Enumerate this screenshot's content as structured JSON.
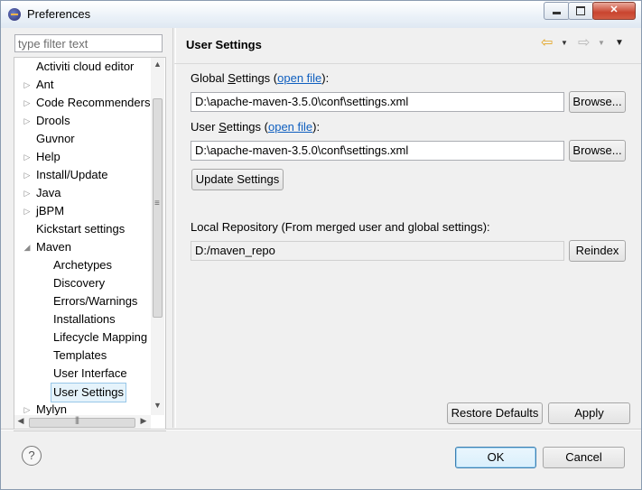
{
  "window": {
    "title": "Preferences"
  },
  "filter": {
    "placeholder": "type filter text"
  },
  "tree": {
    "items": [
      {
        "label": "Activiti cloud editor",
        "expandable": false
      },
      {
        "label": "Ant",
        "expandable": true
      },
      {
        "label": "Code Recommenders",
        "expandable": true
      },
      {
        "label": "Drools",
        "expandable": true
      },
      {
        "label": "Guvnor",
        "expandable": false
      },
      {
        "label": "Help",
        "expandable": true
      },
      {
        "label": "Install/Update",
        "expandable": true
      },
      {
        "label": "Java",
        "expandable": true
      },
      {
        "label": "jBPM",
        "expandable": true
      },
      {
        "label": "Kickstart settings",
        "expandable": false
      },
      {
        "label": "Maven",
        "expandable": true,
        "expanded": true
      },
      {
        "label": "Archetypes",
        "child": true
      },
      {
        "label": "Discovery",
        "child": true
      },
      {
        "label": "Errors/Warnings",
        "child": true
      },
      {
        "label": "Installations",
        "child": true
      },
      {
        "label": "Lifecycle Mapping",
        "child": true
      },
      {
        "label": "Templates",
        "child": true
      },
      {
        "label": "User Interface",
        "child": true
      },
      {
        "label": "User Settings",
        "child": true,
        "selected": true
      },
      {
        "label": "Mylyn",
        "expandable": true
      }
    ]
  },
  "page": {
    "title": "User Settings",
    "global_settings": {
      "label_prefix": "Global ",
      "label_mnemonic": "S",
      "label_suffix": "ettings (",
      "link": "open file",
      "label_end": "):",
      "value": "D:\\apache-maven-3.5.0\\conf\\settings.xml",
      "browse": "Browse..."
    },
    "user_settings": {
      "label_prefix": "User ",
      "label_mnemonic": "S",
      "label_suffix": "ettings (",
      "link": "open file",
      "label_end": "):",
      "value": "D:\\apache-maven-3.5.0\\conf\\settings.xml",
      "browse": "Browse..."
    },
    "update_button": "Update Settings",
    "local_repo": {
      "label": "Local Repository (From merged user and global settings):",
      "value": "D:/maven_repo",
      "reindex": "Reindex"
    },
    "restore_defaults": "Restore Defaults",
    "apply": "Apply"
  },
  "footer": {
    "ok": "OK",
    "cancel": "Cancel",
    "help": "?"
  }
}
